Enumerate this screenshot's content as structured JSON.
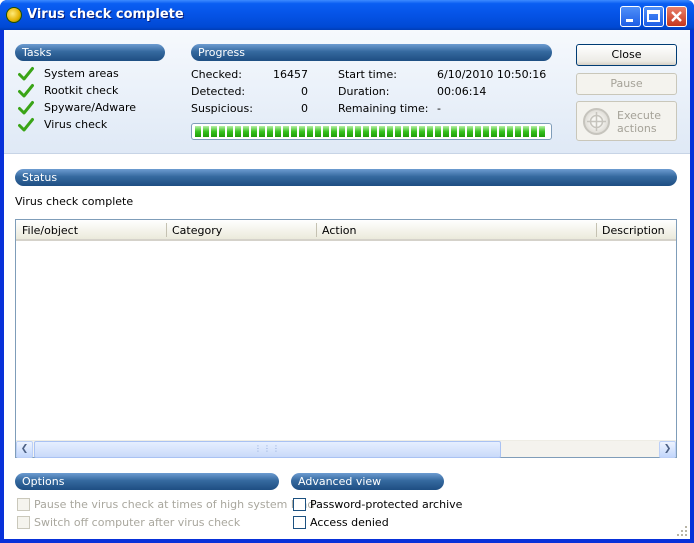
{
  "window": {
    "title": "Virus check complete"
  },
  "tasks": {
    "header": "Tasks",
    "items": [
      "System areas",
      "Rootkit check",
      "Spyware/Adware",
      "Virus check"
    ]
  },
  "progress": {
    "header": "Progress",
    "checked_label": "Checked:",
    "checked_value": "16457",
    "detected_label": "Detected:",
    "detected_value": "0",
    "suspicious_label": "Suspicious:",
    "suspicious_value": "0",
    "start_label": "Start time:",
    "start_value": "6/10/2010 10:50:16",
    "duration_label": "Duration:",
    "duration_value": "00:06:14",
    "remaining_label": "Remaining time:",
    "remaining_value": "-",
    "bar_fraction": 1.0
  },
  "buttons": {
    "close": "Close",
    "pause": "Pause",
    "execute_line1": "Execute",
    "execute_line2": "actions"
  },
  "status": {
    "header": "Status",
    "text": "Virus check complete"
  },
  "table": {
    "columns": [
      "File/object",
      "Category",
      "Action",
      "Description"
    ],
    "rows": []
  },
  "options": {
    "header": "Options",
    "items": [
      {
        "label": "Pause the virus check at times of high system load",
        "checked": false,
        "enabled": false
      },
      {
        "label": "Switch off computer after virus check",
        "checked": false,
        "enabled": false
      }
    ]
  },
  "advanced": {
    "header": "Advanced view",
    "items": [
      {
        "label": "Password-protected archive",
        "checked": false,
        "enabled": true
      },
      {
        "label": "Access denied",
        "checked": false,
        "enabled": true
      }
    ]
  },
  "colors": {
    "titlebar": "#0553e6",
    "pill": "#35699f",
    "progress_fill": "#37c21e",
    "check": "#3aa417"
  },
  "icons": {
    "app": "shield-globe-icon",
    "task_done": "checkmark-icon",
    "execute": "crosshair-icon"
  }
}
